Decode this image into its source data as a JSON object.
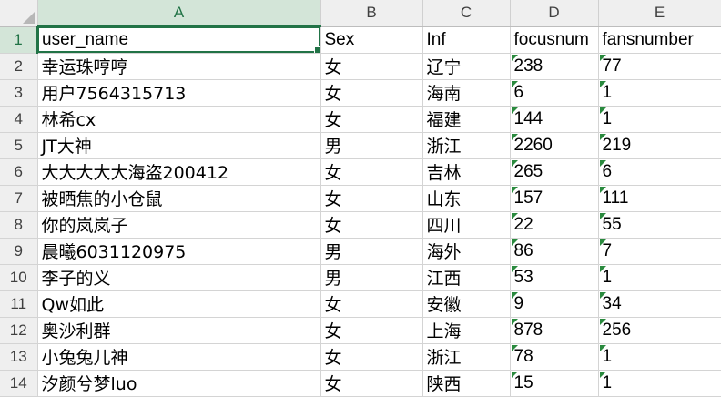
{
  "columns": [
    "A",
    "B",
    "C",
    "D",
    "E"
  ],
  "header_row": {
    "row_number": "1",
    "cells": [
      "user_name",
      "Sex",
      "Inf",
      "focusnum",
      "fansnumber"
    ]
  },
  "rows": [
    {
      "n": "2",
      "user_name": "幸运珠哼哼",
      "sex": " 女",
      "inf": "辽宁",
      "focusnum": "238",
      "fansnumber": "77"
    },
    {
      "n": "3",
      "user_name": "用户7564315713",
      "sex": "女",
      "inf": "海南",
      "focusnum": "6",
      "fansnumber": "1"
    },
    {
      "n": "4",
      "user_name": "林希cx",
      "sex": "女",
      "inf": "福建",
      "focusnum": "144",
      "fansnumber": "1"
    },
    {
      "n": "5",
      "user_name": "JT大神",
      "sex": "男",
      "inf": "浙江",
      "focusnum": "2260",
      "fansnumber": "219"
    },
    {
      "n": "6",
      "user_name": "大大大大大海盗200412",
      "sex": "女",
      "inf": "吉林",
      "focusnum": "265",
      "fansnumber": "6"
    },
    {
      "n": "7",
      "user_name": "被晒焦的小仓鼠",
      "sex": "女",
      "inf": "山东",
      "focusnum": "157",
      "fansnumber": "111"
    },
    {
      "n": "8",
      "user_name": "你的岚岚子",
      "sex": "女",
      "inf": "四川",
      "focusnum": "22",
      "fansnumber": "55"
    },
    {
      "n": "9",
      "user_name": "晨曦6031120975",
      "sex": " 男",
      "inf": "海外",
      "focusnum": "86",
      "fansnumber": "7"
    },
    {
      "n": "10",
      "user_name": "李子的义",
      "sex": "男",
      "inf": "江西",
      "focusnum": "53",
      "fansnumber": "1"
    },
    {
      "n": "11",
      "user_name": "Qw如此",
      "sex": "女",
      "inf": "安徽",
      "focusnum": "9",
      "fansnumber": "34"
    },
    {
      "n": "12",
      "user_name": "奥沙利群",
      "sex": " 女",
      "inf": "上海",
      "focusnum": "878",
      "fansnumber": "256"
    },
    {
      "n": "13",
      "user_name": "小兔兔儿神",
      "sex": "女",
      "inf": "浙江",
      "focusnum": "78",
      "fansnumber": "1"
    },
    {
      "n": "14",
      "user_name": "汐颜兮梦luo",
      "sex": "女",
      "inf": "陕西",
      "focusnum": "15",
      "fansnumber": "1"
    }
  ],
  "selected_cell": "A1",
  "colors": {
    "accent": "#217346",
    "header_bg": "#efefef",
    "active_header_bg": "#d3e5d8",
    "gridline": "#d4d4d4",
    "error_indicator": "#2a8a3e"
  }
}
